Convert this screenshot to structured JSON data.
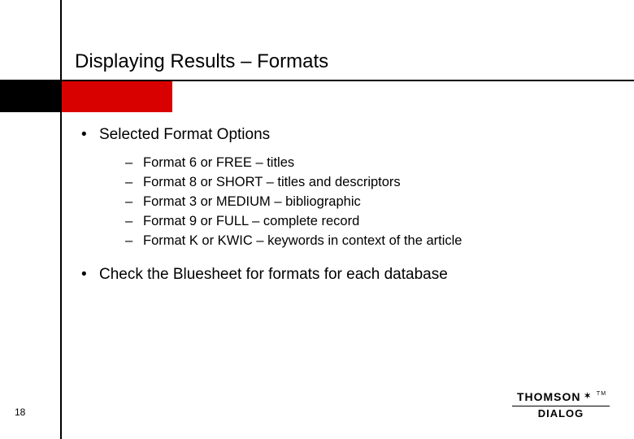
{
  "title": "Displaying Results – Formats",
  "bullets": {
    "item1": {
      "label": "Selected Format Options",
      "sub": [
        "Format 6 or FREE – titles",
        "Format 8 or SHORT – titles and descriptors",
        "Format 3 or MEDIUM – bibliographic",
        "Format 9 or FULL – complete record",
        "Format K or KWIC – keywords in context of the article"
      ]
    },
    "item2": {
      "label": "Check the Bluesheet for formats for each database"
    }
  },
  "page_number": "18",
  "logo": {
    "top": "THOMSON",
    "bottom": "DIALOG",
    "tm": "TM"
  },
  "colors": {
    "accent": "#d90000"
  }
}
